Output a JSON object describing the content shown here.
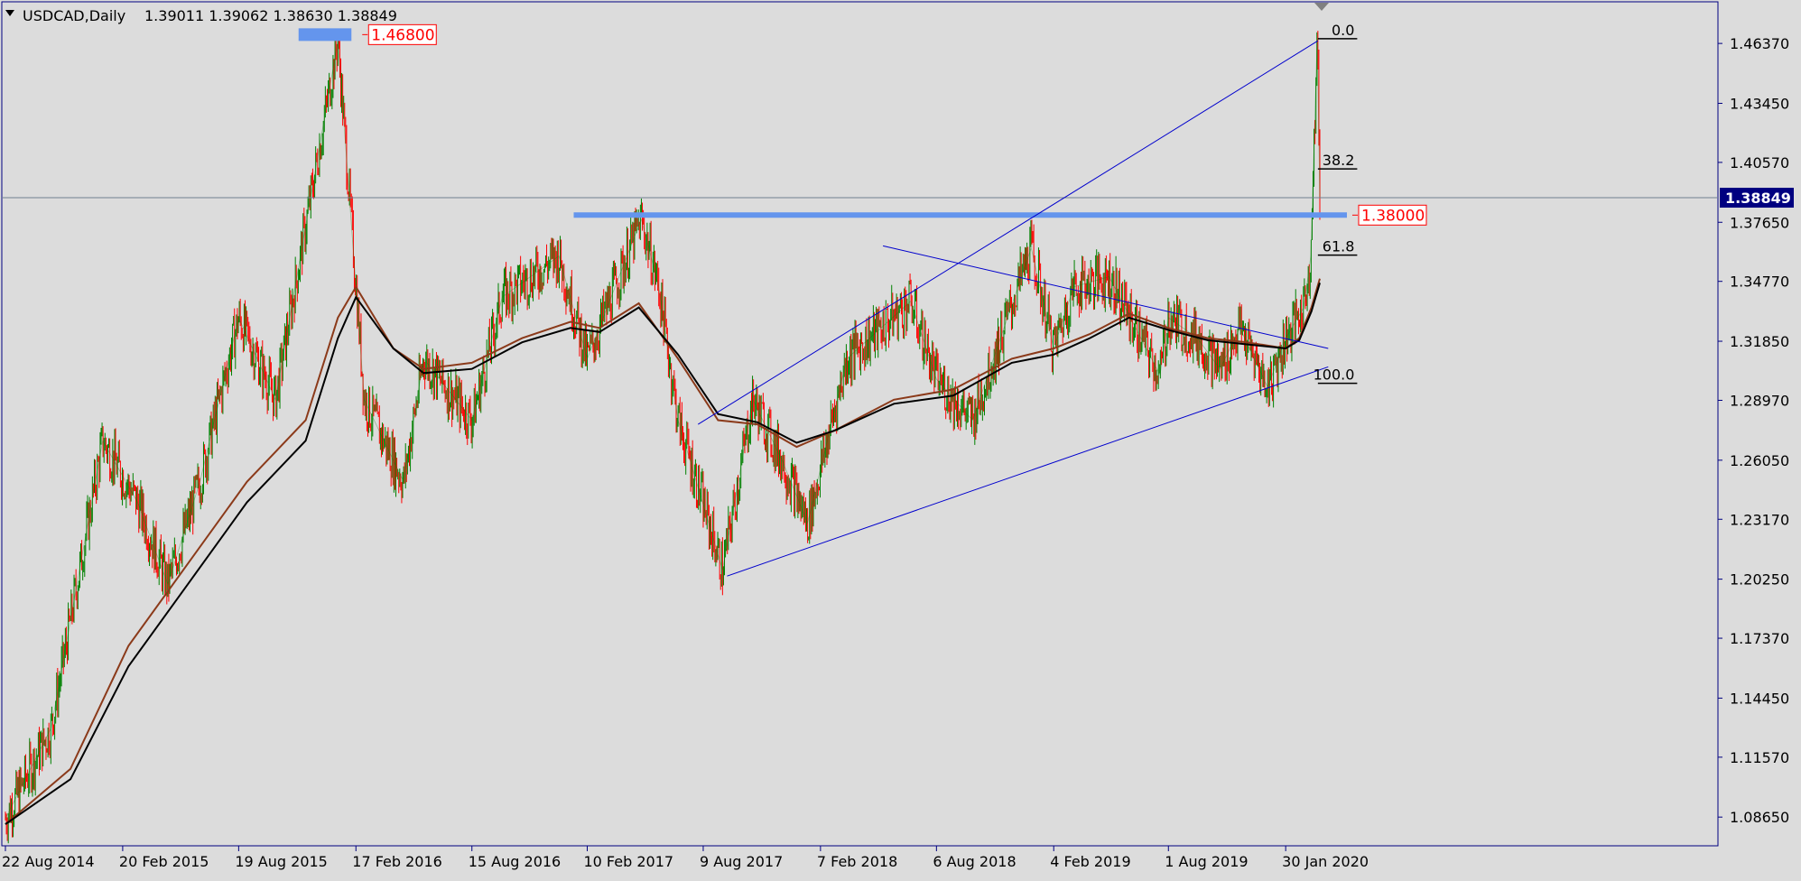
{
  "header": {
    "symbol": "USDCAD,Daily",
    "ohlc": "1.39011 1.39062 1.38630 1.38849"
  },
  "colors": {
    "background": "#dcdcdc",
    "bull": "#008000",
    "bear": "#ff0000",
    "ma_fast": "#8b3a1a",
    "ma_slow": "#000000",
    "trendline": "#0000cd",
    "level_line": "#6495ed",
    "axis_text": "#000000",
    "current_price_bg": "#000080"
  },
  "chart_data": {
    "type": "line",
    "title": "USDCAD,Daily",
    "ylim": [
      1.0725,
      1.484
    ],
    "y_ticks": [
      "1.46370",
      "1.43450",
      "1.40570",
      "1.37650",
      "1.34770",
      "1.31850",
      "1.28970",
      "1.26050",
      "1.23170",
      "1.20250",
      "1.17370",
      "1.14450",
      "1.11570",
      "1.08650"
    ],
    "x_ticks": [
      "22 Aug 2014",
      "20 Feb 2015",
      "19 Aug 2015",
      "17 Feb 2016",
      "15 Aug 2016",
      "10 Feb 2017",
      "9 Aug 2017",
      "7 Feb 2018",
      "6 Aug 2018",
      "4 Feb 2019",
      "1 Aug 2019",
      "30 Jan 2020"
    ],
    "x_dates": [
      "2014-08-22",
      "2015-02-20",
      "2015-08-19",
      "2016-02-17",
      "2016-08-15",
      "2017-02-10",
      "2017-08-09",
      "2018-02-07",
      "2018-08-06",
      "2019-02-04",
      "2019-08-01",
      "2020-01-30"
    ],
    "xlim": [
      "2014-08-22",
      "2020-03-23"
    ],
    "grid": false,
    "current_price": "1.38849",
    "series": [
      {
        "x": [
          "2014-08-22",
          "2014-11-01",
          "2015-01-20",
          "2015-03-15",
          "2015-05-01",
          "2015-06-20",
          "2015-08-19",
          "2015-10-15",
          "2016-01-20",
          "2016-03-01",
          "2016-05-01",
          "2016-06-01",
          "2016-08-15",
          "2016-10-01",
          "2016-12-28",
          "2017-02-10",
          "2017-05-05",
          "2017-06-01",
          "2017-07-01",
          "2017-09-08",
          "2017-10-25",
          "2017-12-10",
          "2018-01-18",
          "2018-03-20",
          "2018-06-27",
          "2018-08-06",
          "2018-10-01",
          "2018-12-31",
          "2019-02-04",
          "2019-03-07",
          "2019-05-01",
          "2019-07-19",
          "2019-08-01",
          "2019-09-15",
          "2019-10-20",
          "2019-11-20",
          "2020-01-02",
          "2020-01-30",
          "2020-02-27",
          "2020-03-09",
          "2020-03-19",
          "2020-03-23"
        ],
        "values": [
          1.0858,
          1.13,
          1.27,
          1.24,
          1.2,
          1.25,
          1.33,
          1.29,
          1.465,
          1.29,
          1.25,
          1.31,
          1.28,
          1.34,
          1.36,
          1.31,
          1.378,
          1.345,
          1.28,
          1.207,
          1.29,
          1.26,
          1.23,
          1.31,
          1.338,
          1.3,
          1.28,
          1.364,
          1.315,
          1.345,
          1.35,
          1.302,
          1.33,
          1.32,
          1.305,
          1.325,
          1.296,
          1.32,
          1.335,
          1.36,
          1.466,
          1.3885
        ]
      },
      {
        "x": [
          "2014-08-22",
          "2014-12-01",
          "2015-03-01",
          "2015-06-01",
          "2015-09-01",
          "2015-12-01",
          "2016-01-20",
          "2016-02-17",
          "2016-04-15",
          "2016-06-01",
          "2016-08-15",
          "2016-11-01",
          "2017-01-15",
          "2017-03-01",
          "2017-05-01",
          "2017-07-01",
          "2017-09-01",
          "2017-11-01",
          "2018-01-01",
          "2018-03-01",
          "2018-06-01",
          "2018-09-01",
          "2018-12-01",
          "2019-02-04",
          "2019-04-01",
          "2019-06-01",
          "2019-08-01",
          "2019-10-01",
          "2019-12-01",
          "2020-01-30",
          "2020-02-20",
          "2020-03-10",
          "2020-03-23"
        ],
        "values": [
          1.083,
          1.11,
          1.17,
          1.21,
          1.25,
          1.28,
          1.33,
          1.345,
          1.315,
          1.305,
          1.308,
          1.32,
          1.328,
          1.325,
          1.337,
          1.31,
          1.28,
          1.278,
          1.267,
          1.275,
          1.29,
          1.295,
          1.31,
          1.315,
          1.322,
          1.332,
          1.325,
          1.32,
          1.318,
          1.315,
          1.32,
          1.335,
          1.349
        ],
        "name": ""
      },
      {
        "x": [
          "2014-08-22",
          "2014-12-01",
          "2015-03-01",
          "2015-06-01",
          "2015-09-01",
          "2015-12-01",
          "2016-01-20",
          "2016-02-17",
          "2016-04-15",
          "2016-06-01",
          "2016-08-15",
          "2016-11-01",
          "2017-01-15",
          "2017-03-01",
          "2017-05-01",
          "2017-07-01",
          "2017-09-01",
          "2017-11-01",
          "2018-01-01",
          "2018-03-01",
          "2018-06-01",
          "2018-09-01",
          "2018-12-01",
          "2019-02-04",
          "2019-04-01",
          "2019-06-01",
          "2019-08-01",
          "2019-10-01",
          "2019-12-01",
          "2020-01-30",
          "2020-02-20",
          "2020-03-10",
          "2020-03-23"
        ],
        "values": [
          1.083,
          1.105,
          1.16,
          1.2,
          1.24,
          1.27,
          1.32,
          1.34,
          1.315,
          1.303,
          1.305,
          1.318,
          1.325,
          1.323,
          1.335,
          1.312,
          1.283,
          1.279,
          1.269,
          1.275,
          1.288,
          1.292,
          1.308,
          1.312,
          1.32,
          1.33,
          1.324,
          1.319,
          1.317,
          1.315,
          1.319,
          1.333,
          1.347
        ],
        "name": ""
      }
    ],
    "horizontal_levels": [
      {
        "value": 1.468,
        "label": "1.46800",
        "from": "2015-11-20",
        "to": "2016-02-10"
      },
      {
        "value": 1.38,
        "label": "1.38000",
        "from": "2017-01-20",
        "to": "2020-03-23"
      }
    ],
    "trendlines": [
      {
        "x": [
          "2017-08-01",
          "2020-03-20"
        ],
        "y": [
          1.278,
          1.465
        ]
      },
      {
        "x": [
          "2017-09-15",
          "2020-04-05"
        ],
        "y": [
          1.204,
          1.306
        ]
      },
      {
        "x": [
          "2018-05-15",
          "2020-04-05"
        ],
        "y": [
          1.365,
          1.315
        ]
      }
    ],
    "fibonacci": {
      "x_from": "2020-03-20",
      "x_to": "2020-05-20",
      "levels": [
        {
          "label": "0.0",
          "value": 1.466
        },
        {
          "label": "38.2",
          "value": 1.4025
        },
        {
          "label": "61.8",
          "value": 1.3605
        },
        {
          "label": "100.0",
          "value": 1.298
        }
      ]
    }
  }
}
